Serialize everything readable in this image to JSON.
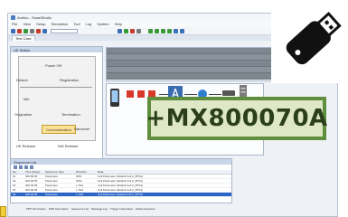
{
  "app": {
    "title": "Anritsu - SmartStudio",
    "menu": [
      "File",
      "View",
      "Setup",
      "Simulation",
      "Tool",
      "Log",
      "System",
      "Help"
    ],
    "active_tab": "Test Case"
  },
  "state_pane": {
    "title": "UE Status",
    "states": {
      "power_off": "Power Off",
      "detach": "Detach",
      "registration": "Registration",
      "idle": "Idle",
      "origination": "Origination",
      "termination": "Termination",
      "communication": "Communication",
      "handover": "Handover",
      "ue_release": "UE Release",
      "nw_release": "NW Release"
    }
  },
  "sequence_list": {
    "title": "Sequence List",
    "columns": [
      "No.",
      "Time Stamp",
      "Sequence Type",
      "Direction",
      "Data"
    ],
    "rows": [
      {
        "no": "61",
        "time": "000:00:05",
        "type": "Parameter",
        "dir": "NW1",
        "data": "Cell Parameter (Default Cell A_BTS1)"
      },
      {
        "no": "62",
        "time": "000:00:05",
        "type": "Parameter",
        "dir": "NW2",
        "data": "Cell Parameter (Default Cell A_BTS1)"
      },
      {
        "no": "63",
        "time": "000:00:05",
        "type": "Parameter",
        "dir": "L-TE1",
        "data": "Cell Parameter (Default Cell A_BTS1)"
      },
      {
        "no": "64",
        "time": "000:00:05",
        "type": "Parameter",
        "dir": "L-TE2",
        "data": "Cell Parameter (Default Cell A_BTS1)"
      },
      {
        "no": "65",
        "time": "000:00:05",
        "type": "Parameter",
        "dir": "L-TE3",
        "data": "Cell Parameter (Default Cell A_BTS1)"
      }
    ],
    "selected_index": 4
  },
  "status_tabs": [
    "PPP Information",
    "PDN Information",
    "Sequence List",
    "Message Log",
    "Trigger Information",
    "Media Sessions"
  ],
  "callout": {
    "part_number": "+MX800070A"
  },
  "colors": {
    "callout_border": "#5f8e3e",
    "callout_fill": "#dfe8c6",
    "selection": "#2b64c4",
    "communication_state": "#f8e199"
  },
  "icons": [
    "usb-stick-icon",
    "phone-icon",
    "base-station-icon",
    "server-icon"
  ]
}
